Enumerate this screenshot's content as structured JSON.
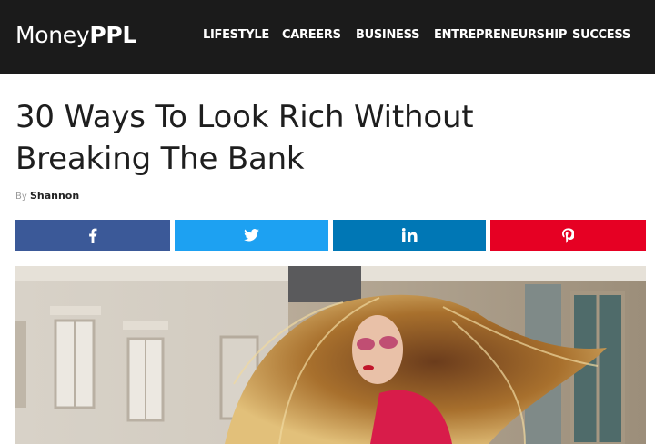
{
  "site": {
    "logo_regular": "Money",
    "logo_bold": "PPL"
  },
  "nav": {
    "items": [
      {
        "label": "LIFESTYLE"
      },
      {
        "label": "CAREERS"
      },
      {
        "label": "BUSINESS"
      },
      {
        "label": "ENTREPRENEURSHIP"
      },
      {
        "label": "SUCCESS"
      }
    ]
  },
  "article": {
    "title_line1": "30 Ways To Look Rich Without",
    "title_line2": "Breaking The Bank",
    "by_label": "By",
    "author": "Shannon"
  },
  "share": {
    "buttons": [
      {
        "network": "facebook",
        "icon": "facebook-icon",
        "color": "#3b5998"
      },
      {
        "network": "twitter",
        "icon": "twitter-icon",
        "color": "#1da1f2"
      },
      {
        "network": "linkedin",
        "icon": "linkedin-icon",
        "color": "#0077b5"
      },
      {
        "network": "pinterest",
        "icon": "pinterest-icon",
        "color": "#e60023"
      }
    ]
  },
  "colors": {
    "header_bg": "#1b1b1b",
    "title_text": "#1e1e1e"
  }
}
